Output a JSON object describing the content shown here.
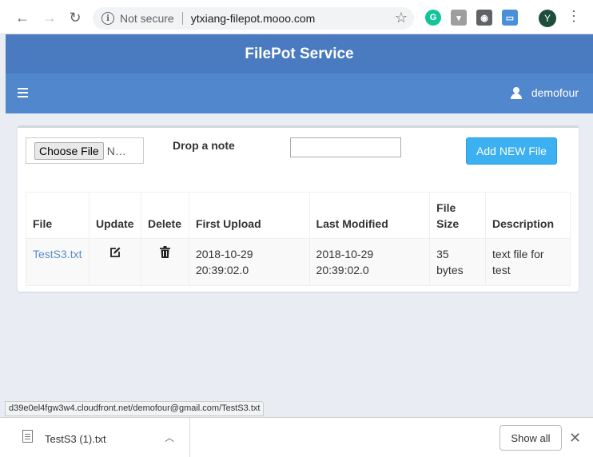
{
  "browser": {
    "security_label": "Not secure",
    "url": "ytxiang-filepot.mooo.com",
    "profile_initial": "Y"
  },
  "app": {
    "title": "FilePot Service",
    "username": "demofour"
  },
  "upload": {
    "choose_file_label": "Choose File",
    "file_status": "N…",
    "drop_note_label": "Drop a note",
    "note_value": "",
    "add_button_label": "Add NEW File"
  },
  "table": {
    "headers": [
      "File",
      "Update",
      "Delete",
      "First Upload",
      "Last Modified",
      "File Size",
      "Description"
    ],
    "rows": [
      {
        "file": "TestS3.txt",
        "update_icon": "edit-icon",
        "delete_icon": "trash-icon",
        "first_upload": "2018-10-29 20:39:02.0",
        "last_modified": "2018-10-29 20:39:02.0",
        "size": "35 bytes",
        "description": "text file for test"
      }
    ]
  },
  "statusbar": {
    "text": "d39e0el4fgw3w4.cloudfront.net/demofour@gmail.com/TestS3.txt"
  },
  "downloads": {
    "item_name": "TestS3 (1).txt",
    "show_all_label": "Show all"
  },
  "colors": {
    "header_bar": "#4a7abf",
    "nav_bar": "#5187cc",
    "add_button": "#3cb0f1",
    "link": "#5b8ec9"
  }
}
